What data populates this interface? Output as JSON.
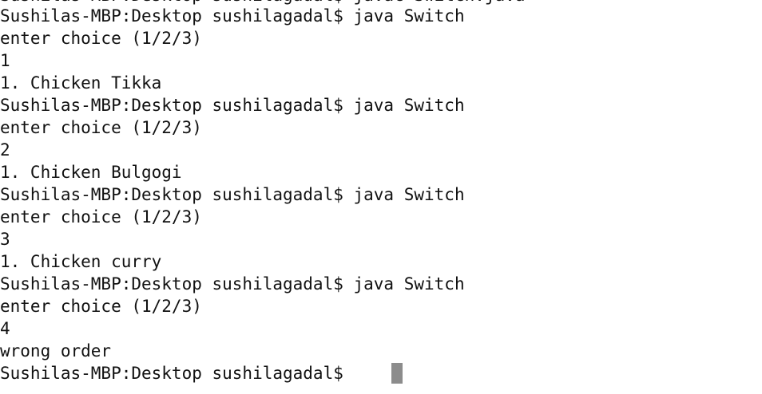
{
  "terminal": {
    "partial_top": "Sushilas-MBP:Desktop sushilagadal$ javac Switch.java",
    "lines": [
      "Sushilas-MBP:Desktop sushilagadal$ java Switch",
      "enter choice (1/2/3)",
      "1",
      "1. Chicken Tikka",
      "Sushilas-MBP:Desktop sushilagadal$ java Switch",
      "enter choice (1/2/3)",
      "2",
      "1. Chicken Bulgogi",
      "Sushilas-MBP:Desktop sushilagadal$ java Switch",
      "enter choice (1/2/3)",
      "3",
      "1. Chicken curry",
      "Sushilas-MBP:Desktop sushilagadal$ java Switch",
      "enter choice (1/2/3)",
      "4",
      "wrong order",
      "Sushilas-MBP:Desktop sushilagadal$ "
    ],
    "colors": {
      "background": "#ffffff",
      "text": "#111111",
      "cursor": "#8c8c8c"
    }
  }
}
